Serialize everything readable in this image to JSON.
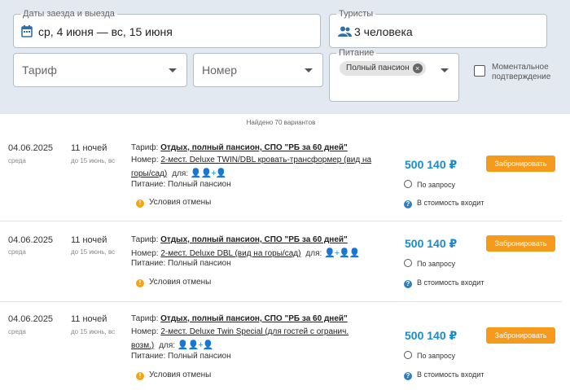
{
  "filters": {
    "dates_legend": "Даты заезда и выезда",
    "dates_value": "ср, 4 июня — вс, 15 июня",
    "tourists_legend": "Туристы",
    "tourists_value": "3 человека",
    "tariff_placeholder": "Тариф",
    "room_placeholder": "Номер",
    "meal_legend": "Питание",
    "meal_chip": "Полный пансион",
    "instant_confirm": "Моментальное подтверждение"
  },
  "found_text": "Найдено 70 вариантов",
  "labels": {
    "tariff": "Тариф:",
    "room": "Номер:",
    "for": "для:",
    "cancel": "Условия отмены",
    "on_request": "По запросу",
    "included": "В стоимость входит",
    "book": "Забронировать"
  },
  "offers": [
    {
      "date": "04.06.2025",
      "weekday": "среда",
      "nights": "11 ночей",
      "till": "до 15 июнь, вс",
      "tariff": "Отдых, полный пансион, СПО \"РБ за 60 дней\"",
      "room_line1": "2-мест. Deluxe TWIN/DBL кровать-трансформер (вид на",
      "room_line2": "горы/сад)",
      "meal": "Питание: Полный пансион",
      "price": "500 140 ₽"
    },
    {
      "date": "04.06.2025",
      "weekday": "среда",
      "nights": "11 ночей",
      "till": "до 15 июнь, вс",
      "tariff": "Отдых, полный пансион, СПО \"РБ за 60 дней\"",
      "room_line1": "2-мест. Deluxe DBL (вид на горы/сад)",
      "meal": "Питание: Полный пансион",
      "price": "500 140 ₽"
    },
    {
      "date": "04.06.2025",
      "weekday": "среда",
      "nights": "11 ночей",
      "till": "до 15 июнь, вс",
      "tariff": "Отдых, полный пансион, СПО \"РБ за 60 дней\"",
      "room_line1": "2-мест. Deluxe Twin Special (для гостей с огранич.",
      "room_line2": "возм.)",
      "meal": "Питание: Полный пансион",
      "price": "500 140 ₽"
    }
  ],
  "colors": {
    "filter_bg": "#e2e9f1",
    "price": "#1a8bc8",
    "book_button": "#f59a1b",
    "person_icon": "#2a8fd0"
  }
}
